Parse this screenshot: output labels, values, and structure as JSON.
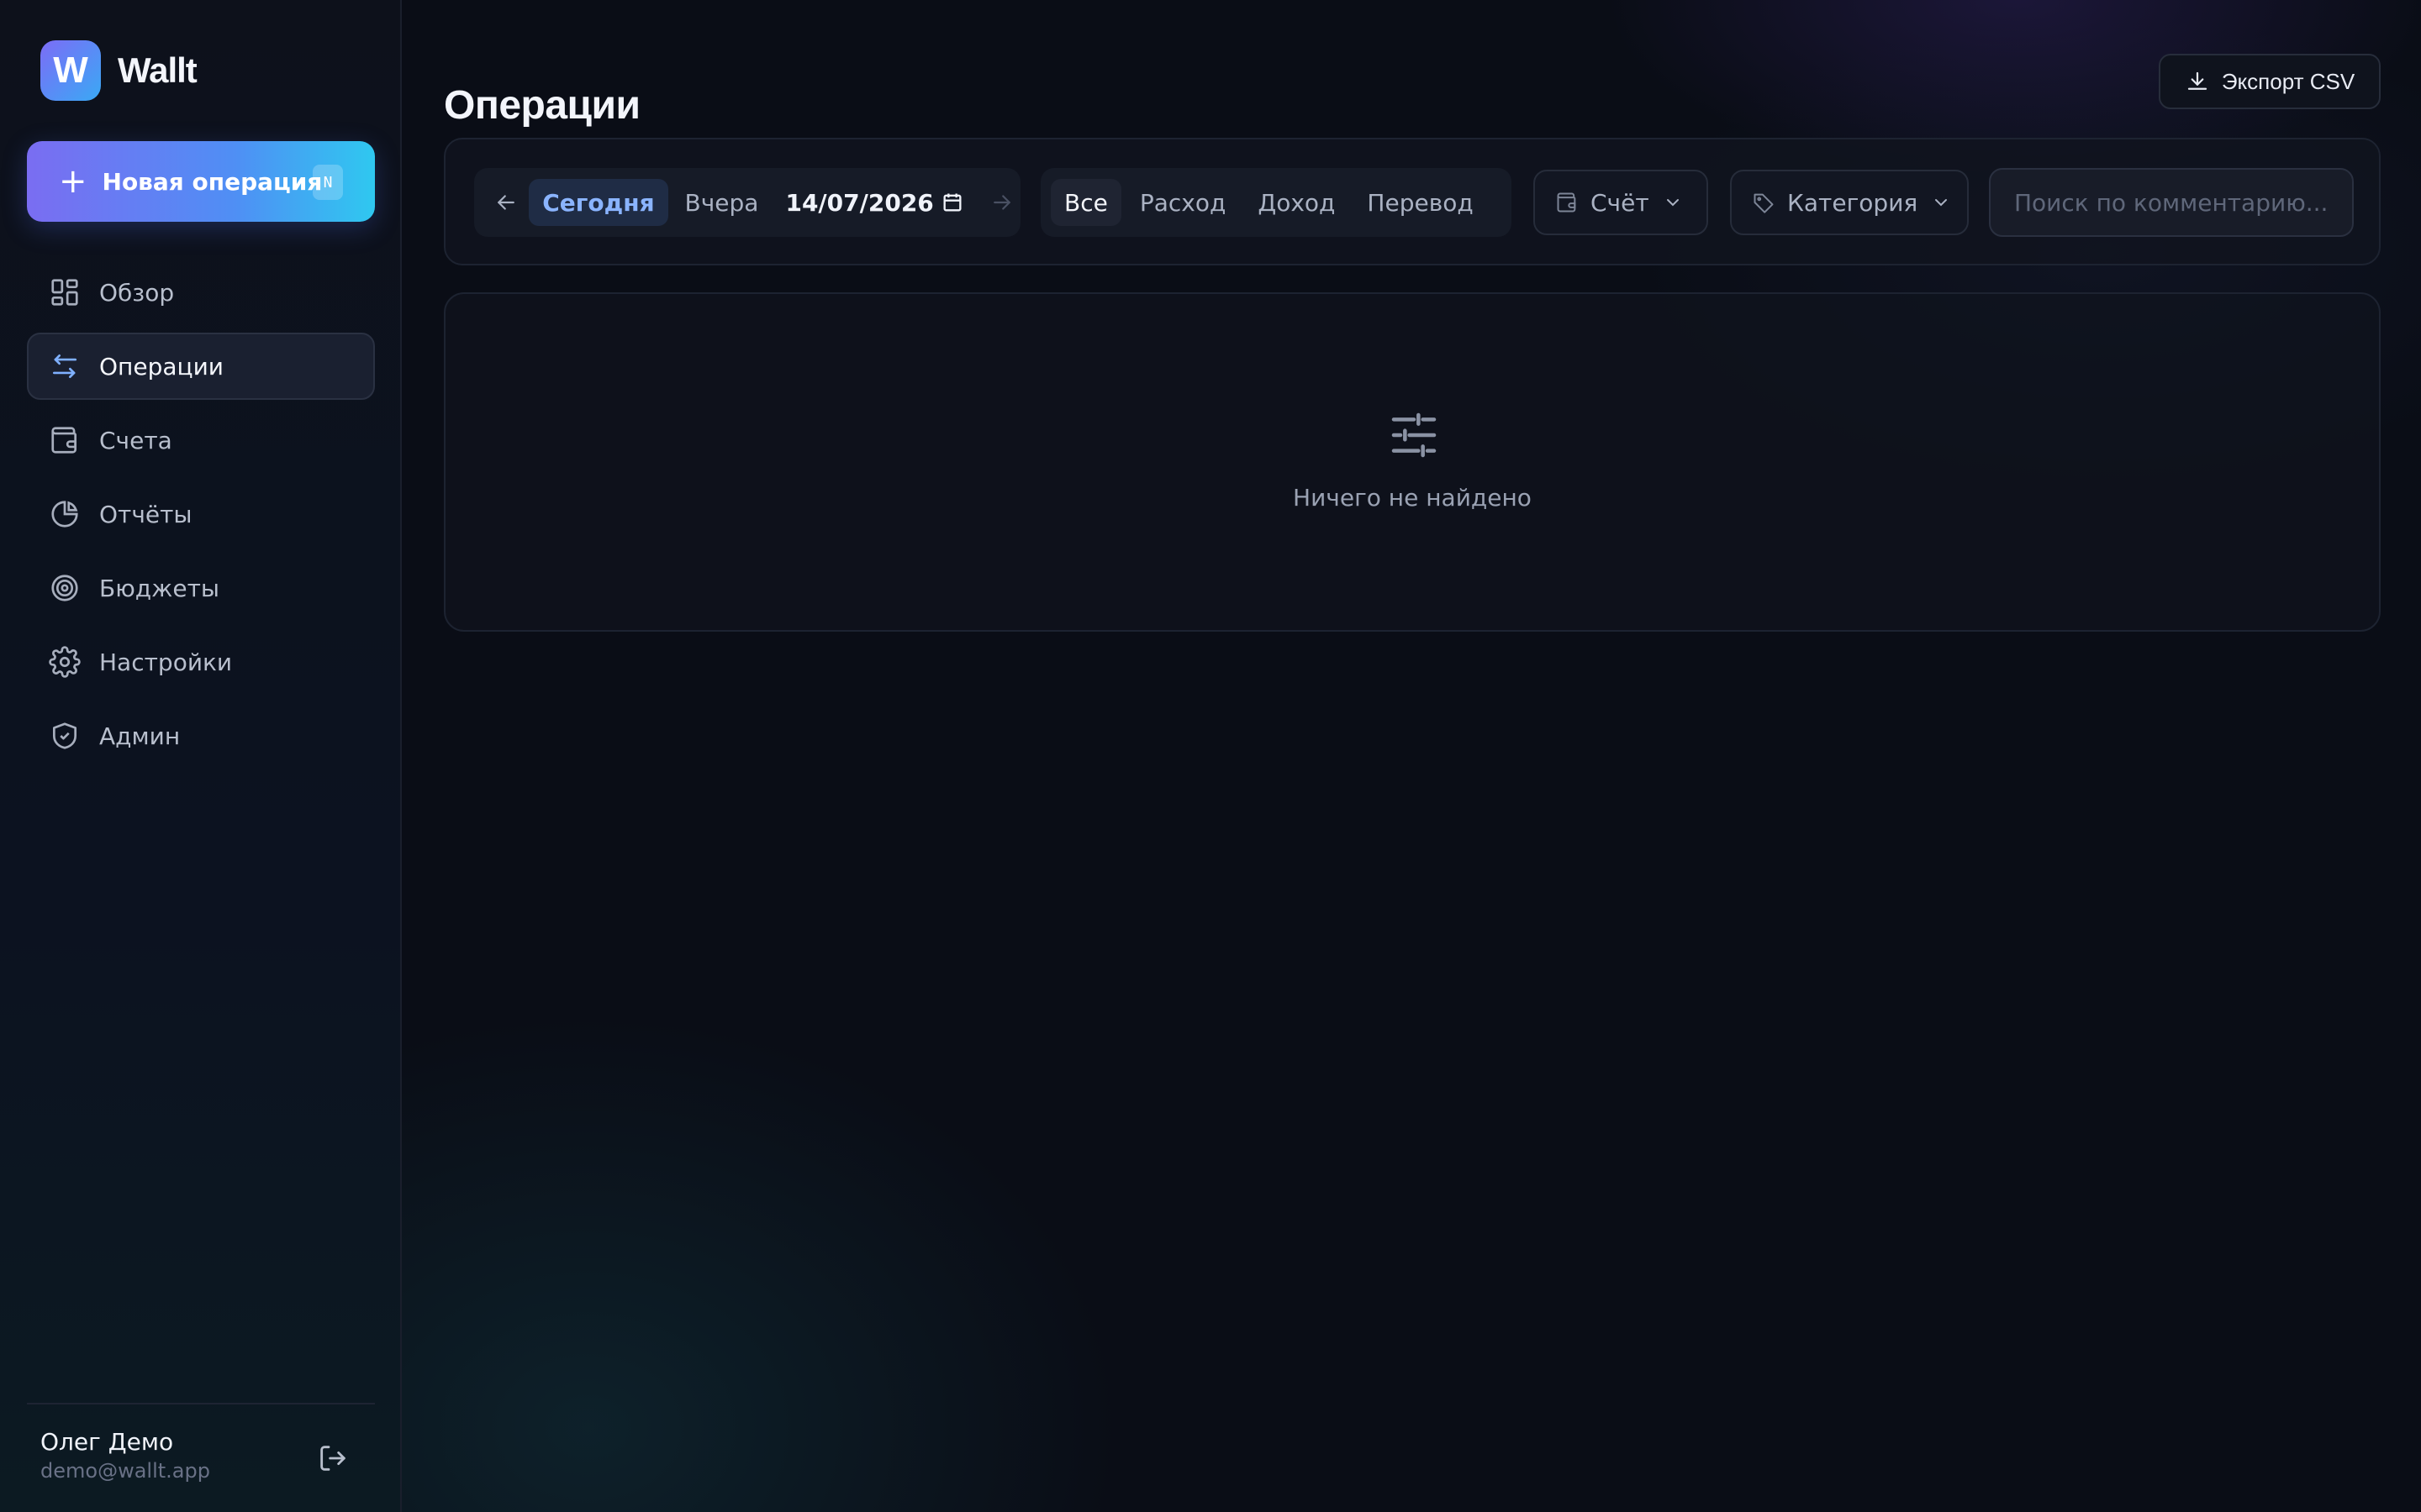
{
  "app": {
    "name": "Wallt",
    "logo_letter": "W"
  },
  "sidebar": {
    "new_op": {
      "label": "Новая операция",
      "shortcut": "N"
    },
    "items": [
      {
        "label": "Обзор",
        "icon": "grid-icon"
      },
      {
        "label": "Операции",
        "icon": "arrows-swap-icon",
        "active": true
      },
      {
        "label": "Счета",
        "icon": "wallet-icon"
      },
      {
        "label": "Отчёты",
        "icon": "pie-chart-icon"
      },
      {
        "label": "Бюджеты",
        "icon": "target-icon"
      },
      {
        "label": "Настройки",
        "icon": "gear-icon"
      },
      {
        "label": "Админ",
        "icon": "shield-icon"
      }
    ],
    "user": {
      "name": "Олег Демо",
      "email": "demo@wallt.app"
    }
  },
  "header": {
    "title": "Операции",
    "export_label": "Экспорт CSV"
  },
  "filters": {
    "date": {
      "today": "Сегодня",
      "yesterday": "Вчера",
      "value": "14/07/2026"
    },
    "types": [
      {
        "label": "Все",
        "active": true
      },
      {
        "label": "Расход"
      },
      {
        "label": "Доход"
      },
      {
        "label": "Перевод"
      }
    ],
    "account_label": "Счёт",
    "category_label": "Категория",
    "search_placeholder": "Поиск по комментарию..."
  },
  "empty_state": {
    "text": "Ничего не найдено"
  },
  "colors": {
    "accent_start": "#7a6df2",
    "accent_end": "#2fc8f0",
    "active_blue": "#8ab4ff",
    "bg": "#0a0d16"
  }
}
